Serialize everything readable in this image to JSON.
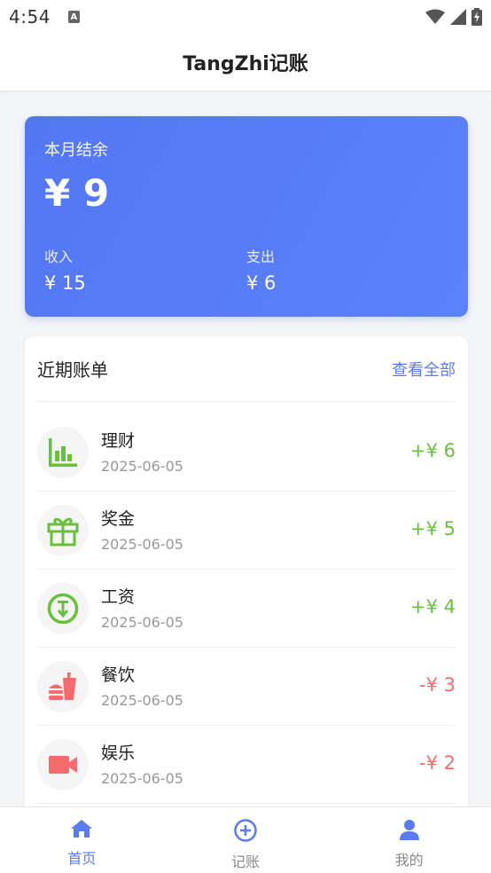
{
  "status_bar": {
    "time": "4:54",
    "a_badge": "A"
  },
  "header": {
    "title": "TangZhi记账"
  },
  "balance": {
    "label": "本月结余",
    "amount": "¥ 9",
    "income_label": "收入",
    "income_value": "¥ 15",
    "expense_label": "支出",
    "expense_value": "¥ 6"
  },
  "bills": {
    "title": "近期账单",
    "view_all": "查看全部",
    "items": [
      {
        "name": "理财",
        "date": "2025-06-05",
        "amount": "+¥ 6",
        "type": "income",
        "icon": "chart-bar-icon"
      },
      {
        "name": "奖金",
        "date": "2025-06-05",
        "amount": "+¥ 5",
        "type": "income",
        "icon": "gift-icon"
      },
      {
        "name": "工资",
        "date": "2025-06-05",
        "amount": "+¥ 4",
        "type": "income",
        "icon": "salary-icon"
      },
      {
        "name": "餐饮",
        "date": "2025-06-05",
        "amount": "-¥ 3",
        "type": "expense",
        "icon": "fast-food-icon"
      },
      {
        "name": "娱乐",
        "date": "2025-06-05",
        "amount": "-¥ 2",
        "type": "expense",
        "icon": "video-camera-icon"
      }
    ]
  },
  "tabs": [
    {
      "label": "首页",
      "icon": "home-icon",
      "active": true
    },
    {
      "label": "记账",
      "icon": "plus-circle-icon",
      "active": false
    },
    {
      "label": "我的",
      "icon": "user-icon",
      "active": false
    }
  ],
  "colors": {
    "accent": "#5b7cf0",
    "income": "#67c23a",
    "expense": "#f56c6c"
  }
}
